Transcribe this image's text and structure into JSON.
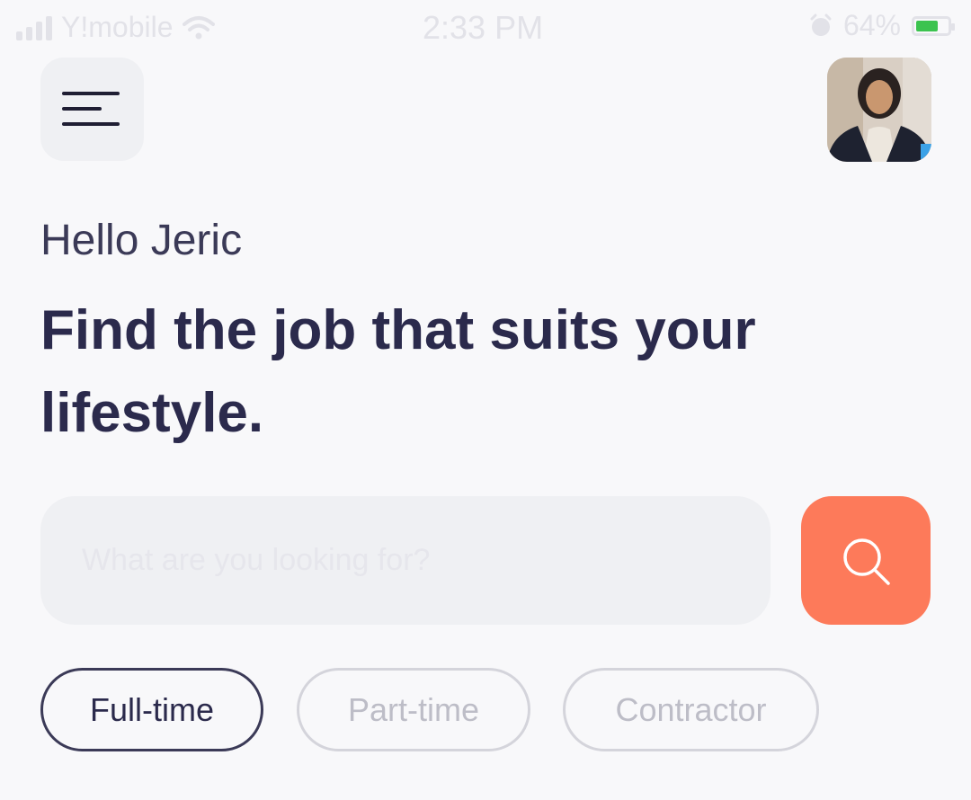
{
  "status_bar": {
    "carrier": "Y!mobile",
    "time": "2:33 PM",
    "battery_percent": "64%",
    "battery_level": 0.64,
    "icons": [
      "signal-icon",
      "wifi-icon",
      "alarm-icon",
      "battery-icon"
    ]
  },
  "header": {
    "menu_icon": "hamburger-menu-icon",
    "avatar_icon": "user-avatar"
  },
  "greeting": "Hello Jeric",
  "headline": "Find the job that suits your lifestyle.",
  "search": {
    "placeholder": "What are you looking for?",
    "value": "",
    "button_icon": "search-icon"
  },
  "filters": {
    "selected": "Full-time",
    "options": [
      "Full-time",
      "Part-time",
      "Contractor"
    ]
  },
  "colors": {
    "background": "#F8F8FA",
    "primary_text": "#2B2A4C",
    "accent": "#FD7A5A",
    "muted": "#BDBDC7",
    "field": "#EFF0F3"
  }
}
